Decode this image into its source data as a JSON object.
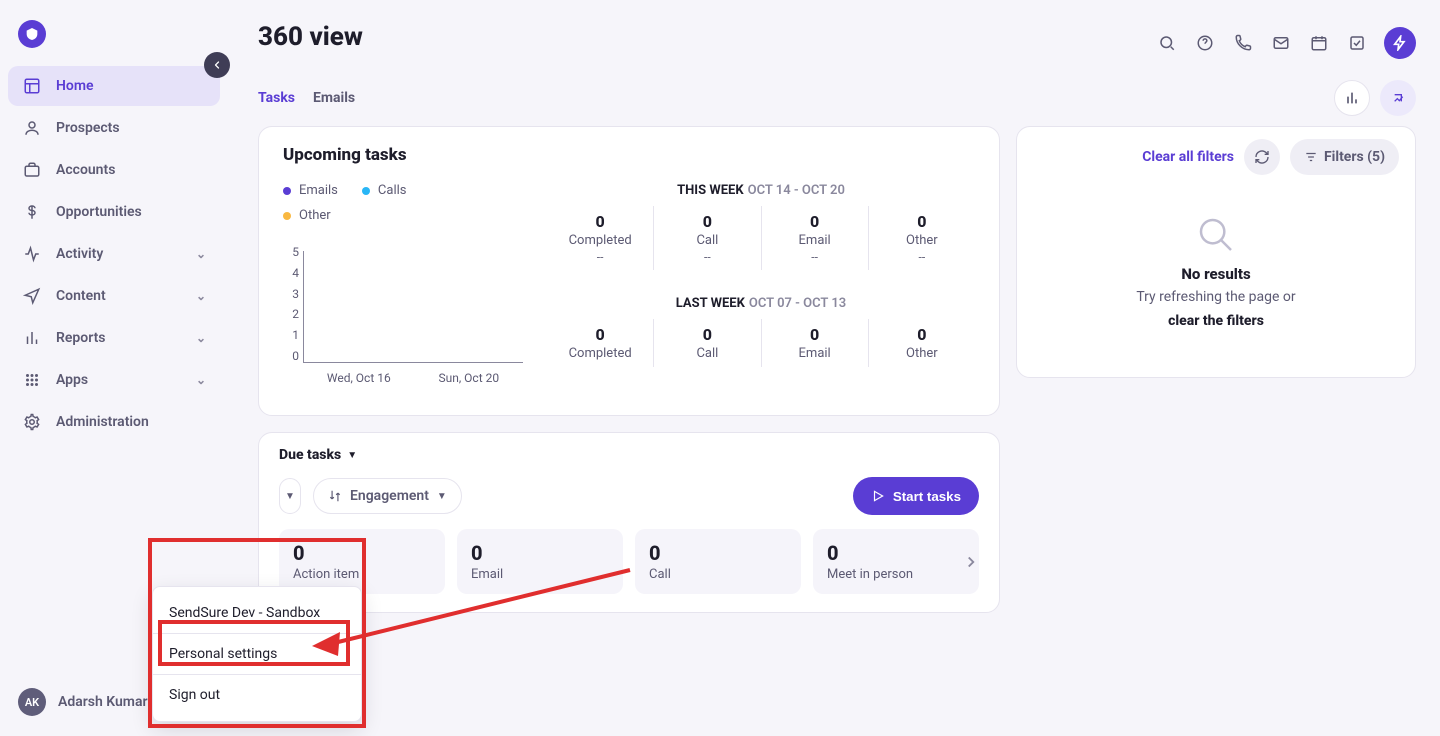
{
  "page_title": "360 view",
  "sidebar": {
    "items": [
      {
        "label": "Home",
        "icon": "layout",
        "active": true,
        "expandable": false
      },
      {
        "label": "Prospects",
        "icon": "user",
        "active": false,
        "expandable": false
      },
      {
        "label": "Accounts",
        "icon": "briefcase",
        "active": false,
        "expandable": false
      },
      {
        "label": "Opportunities",
        "icon": "dollar",
        "active": false,
        "expandable": false
      },
      {
        "label": "Activity",
        "icon": "activity",
        "active": false,
        "expandable": true
      },
      {
        "label": "Content",
        "icon": "send",
        "active": false,
        "expandable": true
      },
      {
        "label": "Reports",
        "icon": "bar",
        "active": false,
        "expandable": true
      },
      {
        "label": "Apps",
        "icon": "grid",
        "active": false,
        "expandable": true
      },
      {
        "label": "Administration",
        "icon": "gear",
        "active": false,
        "expandable": false
      }
    ],
    "user": {
      "initials": "AK",
      "name": "Adarsh Kumar"
    }
  },
  "tabs": {
    "items": [
      {
        "label": "Tasks",
        "active": true
      },
      {
        "label": "Emails",
        "active": false
      }
    ]
  },
  "upcoming": {
    "heading": "Upcoming tasks",
    "legend": [
      {
        "key": "emails",
        "label": "Emails"
      },
      {
        "key": "calls",
        "label": "Calls"
      },
      {
        "key": "other",
        "label": "Other"
      }
    ],
    "this_week": {
      "label": "THIS WEEK",
      "range": "OCT 14 - OCT 20",
      "stats": [
        {
          "num": "0",
          "label": "Completed",
          "sub": "--"
        },
        {
          "num": "0",
          "label": "Call",
          "sub": "--"
        },
        {
          "num": "0",
          "label": "Email",
          "sub": "--"
        },
        {
          "num": "0",
          "label": "Other",
          "sub": "--"
        }
      ]
    },
    "last_week": {
      "label": "LAST WEEK",
      "range": "OCT 07 - OCT 13",
      "stats": [
        {
          "num": "0",
          "label": "Completed"
        },
        {
          "num": "0",
          "label": "Call"
        },
        {
          "num": "0",
          "label": "Email"
        },
        {
          "num": "0",
          "label": "Other"
        }
      ]
    },
    "y_ticks": [
      "5",
      "4",
      "3",
      "2",
      "1",
      "0"
    ],
    "x_ticks": [
      "Wed, Oct 16",
      "Sun, Oct 20"
    ]
  },
  "filters_panel": {
    "clear_label": "Clear all filters",
    "filters_label": "Filters (5)",
    "no_results_title": "No results",
    "no_results_text": "Try refreshing the page or",
    "no_results_link": "clear the filters"
  },
  "due": {
    "heading": "Due tasks",
    "sort_label": "Engagement",
    "start_label": "Start tasks",
    "tiles": [
      {
        "num": "0",
        "label": "Action item"
      },
      {
        "num": "0",
        "label": "Email"
      },
      {
        "num": "0",
        "label": "Call"
      },
      {
        "num": "0",
        "label": "Meet in person"
      }
    ]
  },
  "popup": {
    "org": "SendSure Dev - Sandbox",
    "settings": "Personal settings",
    "signout": "Sign out"
  },
  "chart_data": {
    "type": "bar",
    "categories": [
      "Wed, Oct 16",
      "Sun, Oct 20"
    ],
    "series": [
      {
        "name": "Emails",
        "values": [
          0,
          0
        ]
      },
      {
        "name": "Calls",
        "values": [
          0,
          0
        ]
      },
      {
        "name": "Other",
        "values": [
          0,
          0
        ]
      }
    ],
    "ylim": [
      0,
      5
    ],
    "xlabel": "",
    "ylabel": ""
  }
}
